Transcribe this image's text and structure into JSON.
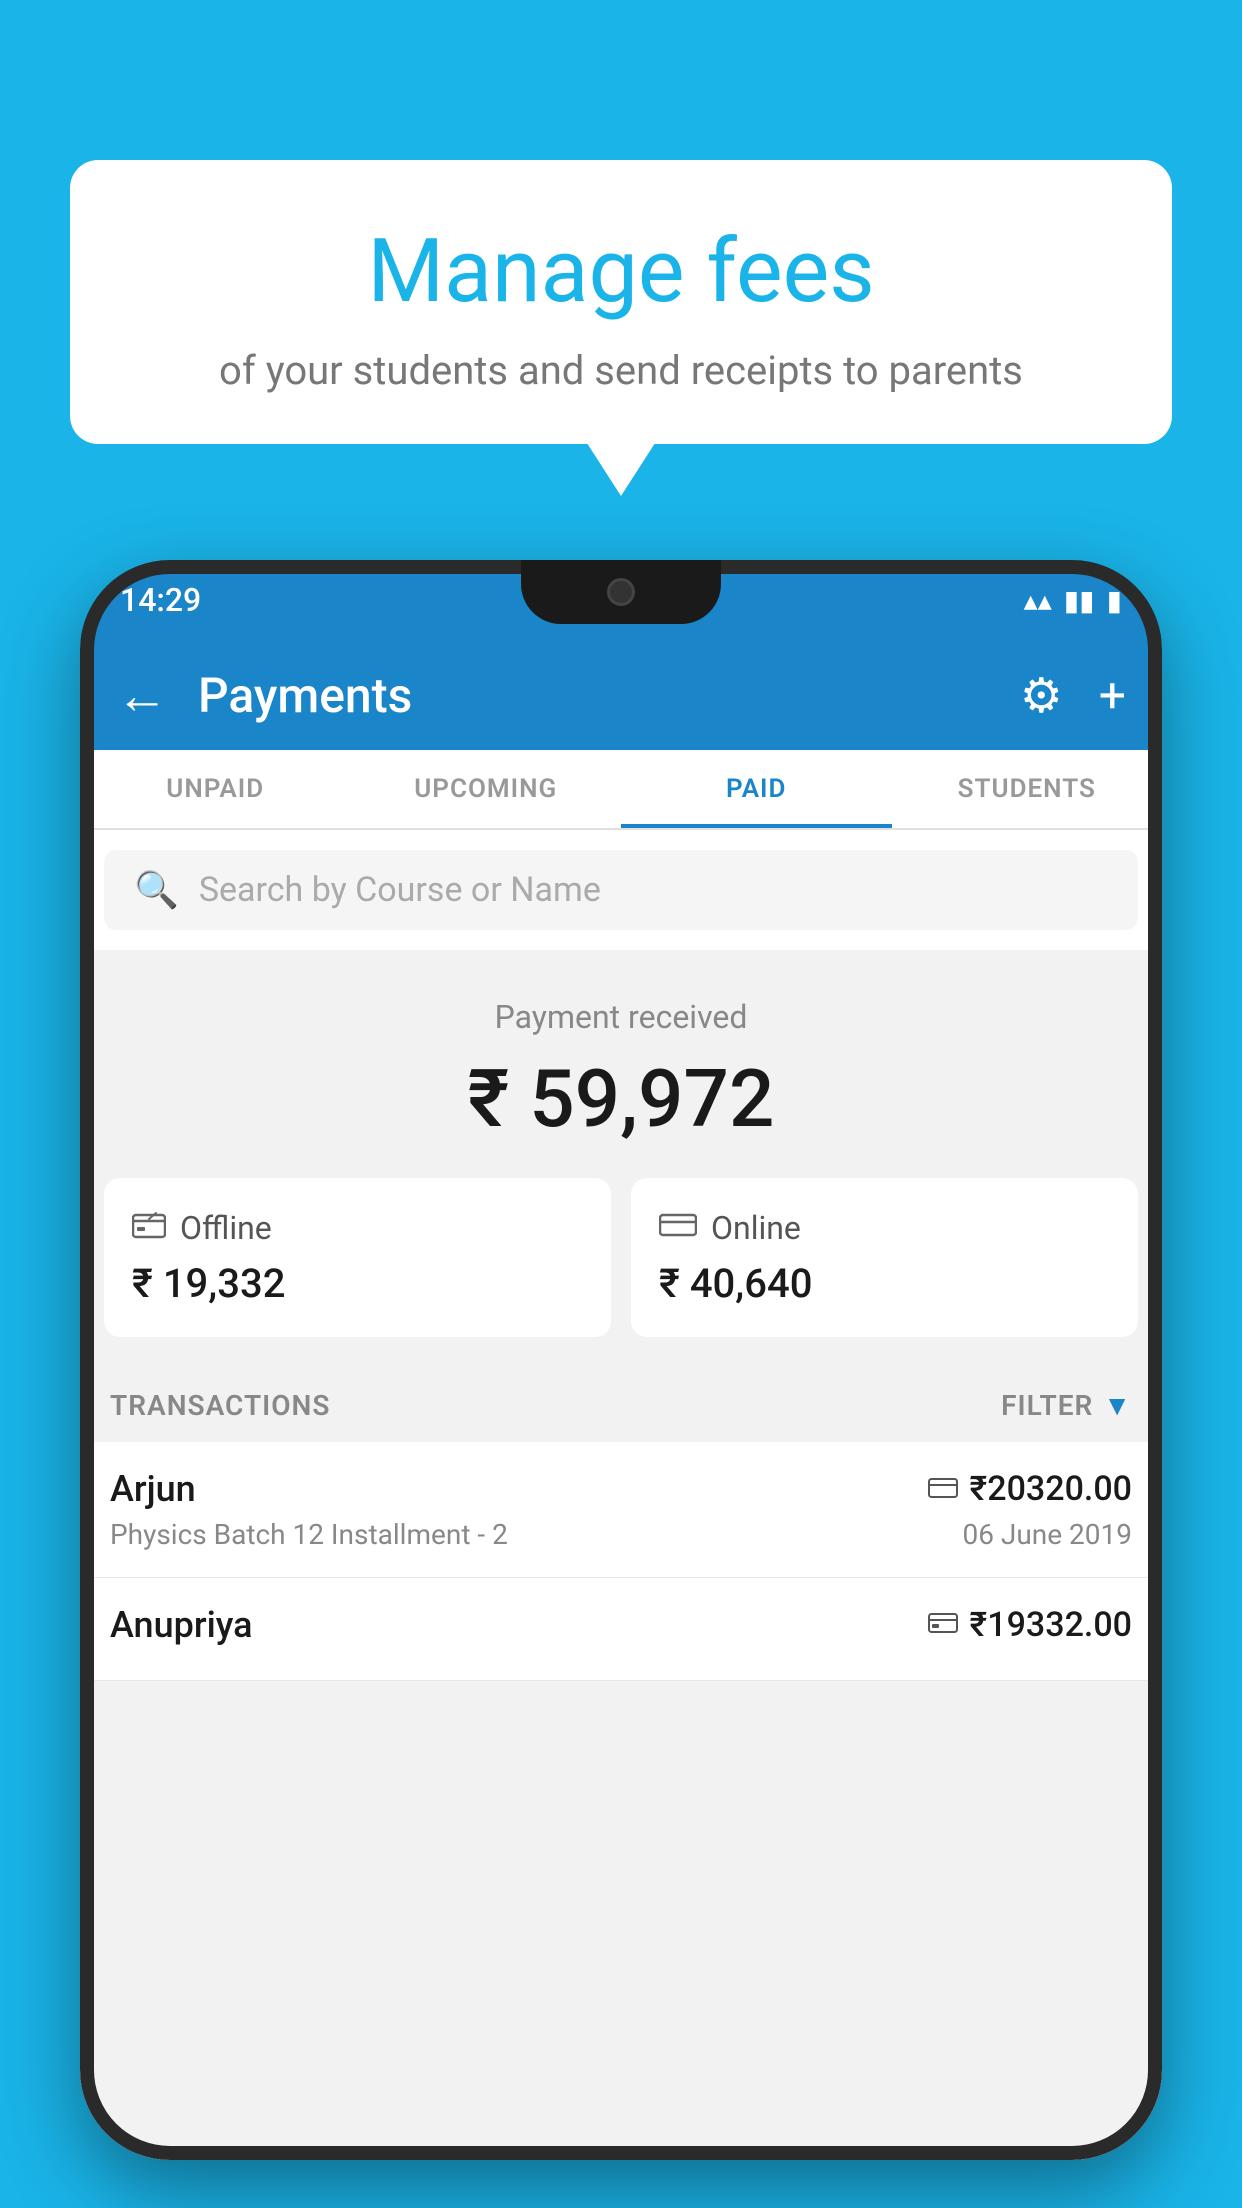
{
  "background_color": "#1ab4e8",
  "speech_bubble": {
    "title": "Manage fees",
    "subtitle": "of your students and send receipts to parents"
  },
  "status_bar": {
    "time": "14:29",
    "wifi_icon": "▼",
    "signal_icon": "▲",
    "battery_icon": "▮"
  },
  "top_bar": {
    "title": "Payments",
    "back_icon": "←",
    "gear_icon": "⚙",
    "plus_icon": "+"
  },
  "tabs": [
    {
      "label": "UNPAID",
      "active": false
    },
    {
      "label": "UPCOMING",
      "active": false
    },
    {
      "label": "PAID",
      "active": true
    },
    {
      "label": "STUDENTS",
      "active": false
    }
  ],
  "search": {
    "placeholder": "Search by Course or Name",
    "search_icon": "🔍"
  },
  "payment_received": {
    "label": "Payment received",
    "amount": "₹ 59,972"
  },
  "payment_cards": [
    {
      "icon": "offline",
      "label": "Offline",
      "amount": "₹ 19,332"
    },
    {
      "icon": "online",
      "label": "Online",
      "amount": "₹ 40,640"
    }
  ],
  "transactions_section": {
    "label": "TRANSACTIONS",
    "filter_label": "FILTER"
  },
  "transactions": [
    {
      "name": "Arjun",
      "payment_type": "card",
      "amount": "₹20320.00",
      "detail": "Physics Batch 12 Installment - 2",
      "date": "06 June 2019"
    },
    {
      "name": "Anupriya",
      "payment_type": "offline",
      "amount": "₹19332.00",
      "detail": "",
      "date": ""
    }
  ]
}
